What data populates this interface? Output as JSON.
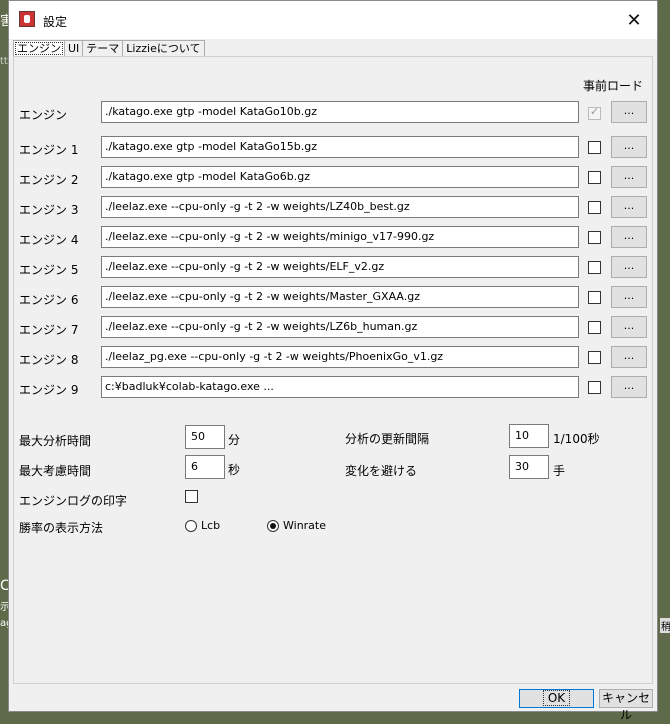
{
  "background": {
    "frag_a": "害",
    "frag_b": "ttp",
    "frag_c": "C",
    "frag_d": "示",
    "frag_e": "ag",
    "frag_f": "稍"
  },
  "window": {
    "title": "設定"
  },
  "tabs": [
    {
      "label": "エンジン",
      "active": true
    },
    {
      "label": "UI"
    },
    {
      "label": "テーマ"
    },
    {
      "label": "Lizzieについて"
    }
  ],
  "engines": {
    "preload_header": "事前ロード",
    "browse_label": "...",
    "rows": [
      {
        "label": "エンジン",
        "command": "./katago.exe gtp -model KataGo10b.gz",
        "preload": true
      },
      {
        "label": "エンジン 1",
        "command": "./katago.exe gtp -model KataGo15b.gz",
        "preload": false
      },
      {
        "label": "エンジン 2",
        "command": "./katago.exe gtp -model KataGo6b.gz",
        "preload": false
      },
      {
        "label": "エンジン 3",
        "command": "./leelaz.exe --cpu-only -g -t 2 -w weights/LZ40b_best.gz",
        "preload": false
      },
      {
        "label": "エンジン 4",
        "command": "./leelaz.exe --cpu-only -g -t 2 -w weights/minigo_v17-990.gz",
        "preload": false
      },
      {
        "label": "エンジン 5",
        "command": "./leelaz.exe --cpu-only -g -t 2 -w weights/ELF_v2.gz",
        "preload": false
      },
      {
        "label": "エンジン 6",
        "command": "./leelaz.exe --cpu-only -g -t 2 -w weights/Master_GXAA.gz",
        "preload": false
      },
      {
        "label": "エンジン 7",
        "command": "./leelaz.exe --cpu-only -g -t 2 -w weights/LZ6b_human.gz",
        "preload": false
      },
      {
        "label": "エンジン 8",
        "command": "./leelaz_pg.exe --cpu-only -g -t 2 -w weights/PhoenixGo_v1.gz",
        "preload": false
      },
      {
        "label": "エンジン 9",
        "command": "c:¥badluk¥colab-katago.exe ...",
        "preload": false
      }
    ]
  },
  "options": {
    "max_analysis_time": {
      "label": "最大分析時間",
      "value": "50",
      "unit": "分"
    },
    "max_think_time": {
      "label": "最大考慮時間",
      "value": "6",
      "unit": "秒"
    },
    "update_interval": {
      "label": "分析の更新間隔",
      "value": "10",
      "unit": "1/100秒"
    },
    "avoid_change": {
      "label": "変化を避ける",
      "value": "30",
      "unit": "手"
    },
    "engine_log": {
      "label": "エンジンログの印字",
      "checked": false
    },
    "winrate_display": {
      "label": "勝率の表示方法",
      "options": [
        "Lcb",
        "Winrate"
      ],
      "selected": "Winrate"
    }
  },
  "buttons": {
    "ok": "OK",
    "cancel": "キャンセル"
  }
}
